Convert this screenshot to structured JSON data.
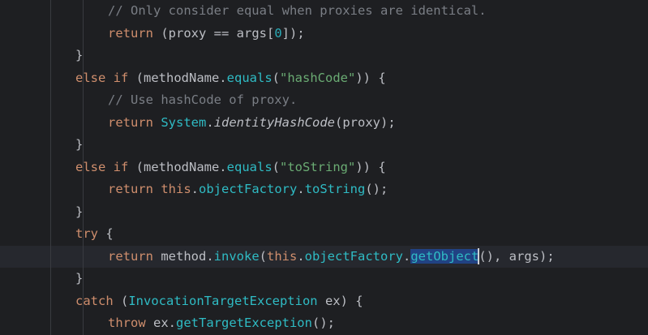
{
  "editor": {
    "lines": [
      {
        "indent": 2,
        "tokens": [
          {
            "t": "// Only consider equal when proxies are identical.",
            "c": "cm"
          }
        ]
      },
      {
        "indent": 2,
        "tokens": [
          {
            "t": "return",
            "c": "kw"
          },
          {
            "t": " (proxy == args[",
            "c": "plain"
          },
          {
            "t": "0",
            "c": "num"
          },
          {
            "t": "]);",
            "c": "plain"
          }
        ]
      },
      {
        "indent": 1,
        "tokens": [
          {
            "t": "}",
            "c": "plain"
          }
        ]
      },
      {
        "indent": 1,
        "tokens": [
          {
            "t": "else if",
            "c": "kw"
          },
          {
            "t": " (methodName.",
            "c": "plain"
          },
          {
            "t": "equals",
            "c": "cls"
          },
          {
            "t": "(",
            "c": "plain"
          },
          {
            "t": "\"hashCode\"",
            "c": "str"
          },
          {
            "t": ")) {",
            "c": "plain"
          }
        ]
      },
      {
        "indent": 2,
        "tokens": [
          {
            "t": "// Use hashCode of proxy.",
            "c": "cm"
          }
        ]
      },
      {
        "indent": 2,
        "tokens": [
          {
            "t": "return",
            "c": "kw"
          },
          {
            "t": " ",
            "c": "plain"
          },
          {
            "t": "System",
            "c": "sys"
          },
          {
            "t": ".",
            "c": "plain"
          },
          {
            "t": "identityHashCode",
            "c": "ital"
          },
          {
            "t": "(proxy);",
            "c": "plain"
          }
        ]
      },
      {
        "indent": 1,
        "tokens": [
          {
            "t": "}",
            "c": "plain"
          }
        ]
      },
      {
        "indent": 1,
        "tokens": [
          {
            "t": "else if",
            "c": "kw"
          },
          {
            "t": " (methodName.",
            "c": "plain"
          },
          {
            "t": "equals",
            "c": "cls"
          },
          {
            "t": "(",
            "c": "plain"
          },
          {
            "t": "\"toString\"",
            "c": "str"
          },
          {
            "t": ")) {",
            "c": "plain"
          }
        ]
      },
      {
        "indent": 2,
        "tokens": [
          {
            "t": "return",
            "c": "kw"
          },
          {
            "t": " ",
            "c": "plain"
          },
          {
            "t": "this",
            "c": "kw"
          },
          {
            "t": ".",
            "c": "plain"
          },
          {
            "t": "objectFactory",
            "c": "cls"
          },
          {
            "t": ".",
            "c": "plain"
          },
          {
            "t": "toString",
            "c": "cls"
          },
          {
            "t": "();",
            "c": "plain"
          }
        ]
      },
      {
        "indent": 1,
        "tokens": [
          {
            "t": "}",
            "c": "plain"
          }
        ]
      },
      {
        "indent": 1,
        "tokens": [
          {
            "t": "try",
            "c": "kw"
          },
          {
            "t": " {",
            "c": "plain"
          }
        ]
      },
      {
        "indent": 2,
        "current": true,
        "tokens": [
          {
            "t": "return",
            "c": "kw"
          },
          {
            "t": " method.",
            "c": "plain"
          },
          {
            "t": "invoke",
            "c": "cls"
          },
          {
            "t": "(",
            "c": "plain"
          },
          {
            "t": "this",
            "c": "kw"
          },
          {
            "t": ".",
            "c": "plain"
          },
          {
            "t": "objectFactory",
            "c": "cls"
          },
          {
            "t": ".",
            "c": "plain"
          },
          {
            "t": "getObject",
            "c": "cls sel"
          },
          {
            "caret": true
          },
          {
            "t": "(), args);",
            "c": "plain"
          }
        ]
      },
      {
        "indent": 1,
        "tokens": [
          {
            "t": "}",
            "c": "plain"
          }
        ]
      },
      {
        "indent": 1,
        "tokens": [
          {
            "t": "catch",
            "c": "kw"
          },
          {
            "t": " (",
            "c": "plain"
          },
          {
            "t": "InvocationTargetException",
            "c": "cls"
          },
          {
            "t": " ex) {",
            "c": "plain"
          }
        ]
      },
      {
        "indent": 2,
        "tokens": [
          {
            "t": "throw",
            "c": "kw"
          },
          {
            "t": " ex.",
            "c": "plain"
          },
          {
            "t": "getTargetException",
            "c": "cls"
          },
          {
            "t": "();",
            "c": "plain"
          }
        ]
      }
    ]
  }
}
